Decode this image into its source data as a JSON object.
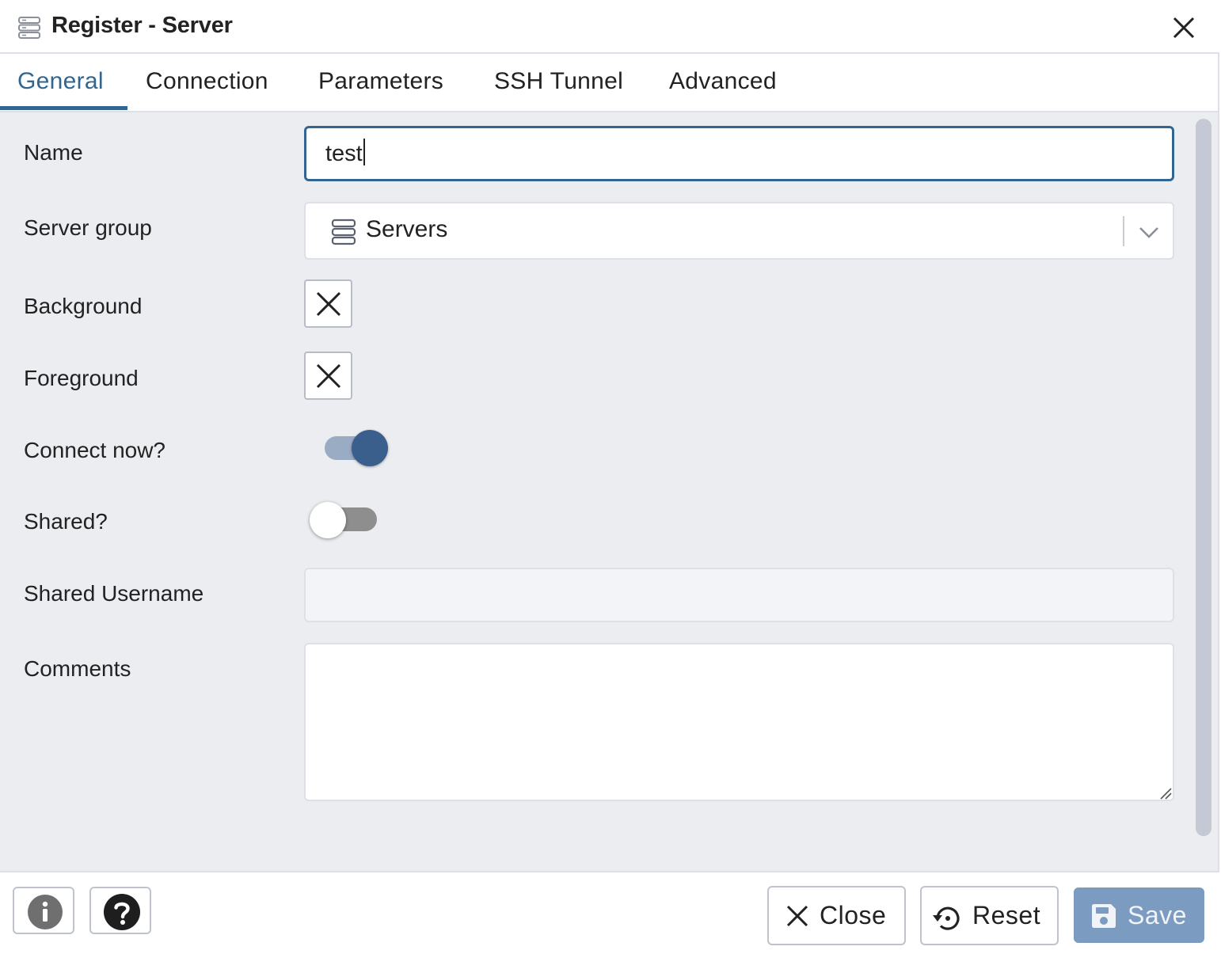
{
  "dialog": {
    "title": "Register - Server",
    "title_icon": "server-group-icon",
    "close_icon": "close-icon"
  },
  "tabs": [
    {
      "label": "General",
      "active": true
    },
    {
      "label": "Connection",
      "active": false
    },
    {
      "label": "Parameters",
      "active": false
    },
    {
      "label": "SSH Tunnel",
      "active": false
    },
    {
      "label": "Advanced",
      "active": false
    }
  ],
  "form": {
    "name": {
      "label": "Name",
      "value": "test"
    },
    "server_group": {
      "label": "Server group",
      "value": "Servers",
      "icon": "server-group-icon"
    },
    "background": {
      "label": "Background",
      "value_icon": "clear-color-icon"
    },
    "foreground": {
      "label": "Foreground",
      "value_icon": "clear-color-icon"
    },
    "connect_now": {
      "label": "Connect now?",
      "checked": true
    },
    "shared": {
      "label": "Shared?",
      "checked": false
    },
    "shared_username": {
      "label": "Shared Username",
      "value": "",
      "disabled": true
    },
    "comments": {
      "label": "Comments",
      "value": ""
    }
  },
  "footer": {
    "info_icon": "info-icon",
    "help_icon": "help-icon",
    "close_label": "Close",
    "reset_label": "Reset",
    "save_label": "Save",
    "save_disabled": true
  },
  "colors": {
    "accent": "#326690",
    "panel_bg": "#ebedf1",
    "save_disabled_bg": "#7b9cc0",
    "toggle_on_knob": "#3b5f8d"
  }
}
